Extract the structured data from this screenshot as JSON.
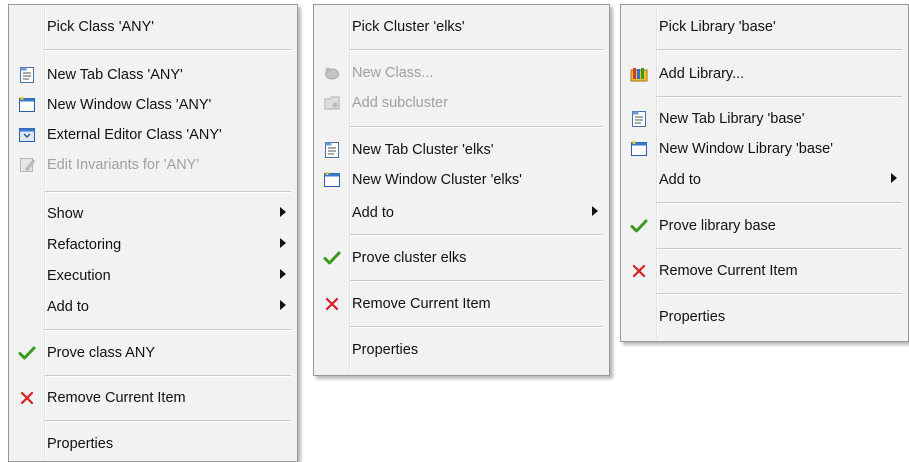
{
  "menus": [
    {
      "items": [
        {
          "label": "Pick Class 'ANY'",
          "icon": null,
          "submenu": false,
          "disabled": false
        },
        {
          "label": "New Tab Class 'ANY'",
          "icon": "new-tab-icon",
          "submenu": false,
          "disabled": false
        },
        {
          "label": "New Window Class 'ANY'",
          "icon": "new-window-icon",
          "submenu": false,
          "disabled": false
        },
        {
          "label": "External Editor Class 'ANY'",
          "icon": "external-editor-icon",
          "submenu": false,
          "disabled": false
        },
        {
          "label": "Edit Invariants for 'ANY'",
          "icon": "edit-invariants-icon",
          "submenu": false,
          "disabled": true
        },
        {
          "label": "Show",
          "icon": null,
          "submenu": true,
          "disabled": false
        },
        {
          "label": "Refactoring",
          "icon": null,
          "submenu": true,
          "disabled": false
        },
        {
          "label": "Execution",
          "icon": null,
          "submenu": true,
          "disabled": false
        },
        {
          "label": "Add to",
          "icon": null,
          "submenu": true,
          "disabled": false
        },
        {
          "label": "Prove class ANY",
          "icon": "check-icon",
          "submenu": false,
          "disabled": false
        },
        {
          "label": "Remove Current Item",
          "icon": "remove-icon",
          "submenu": false,
          "disabled": false
        },
        {
          "label": "Properties",
          "icon": null,
          "submenu": false,
          "disabled": false
        }
      ]
    },
    {
      "items": [
        {
          "label": "Pick Cluster 'elks'",
          "icon": null,
          "submenu": false,
          "disabled": false
        },
        {
          "label": "New Class...",
          "icon": "new-class-icon",
          "submenu": false,
          "disabled": true
        },
        {
          "label": "Add subcluster",
          "icon": "add-subcluster-icon",
          "submenu": false,
          "disabled": true
        },
        {
          "label": "New Tab Cluster 'elks'",
          "icon": "new-tab-icon",
          "submenu": false,
          "disabled": false
        },
        {
          "label": "New Window Cluster 'elks'",
          "icon": "new-window-icon",
          "submenu": false,
          "disabled": false
        },
        {
          "label": "Add to",
          "icon": null,
          "submenu": true,
          "disabled": false
        },
        {
          "label": "Prove cluster elks",
          "icon": "check-icon",
          "submenu": false,
          "disabled": false
        },
        {
          "label": "Remove Current Item",
          "icon": "remove-icon",
          "submenu": false,
          "disabled": false
        },
        {
          "label": "Properties",
          "icon": null,
          "submenu": false,
          "disabled": false
        }
      ]
    },
    {
      "items": [
        {
          "label": "Pick Library 'base'",
          "icon": null,
          "submenu": false,
          "disabled": false
        },
        {
          "label": "Add Library...",
          "icon": "add-library-icon",
          "submenu": false,
          "disabled": false
        },
        {
          "label": "New Tab Library 'base'",
          "icon": "new-tab-icon",
          "submenu": false,
          "disabled": false
        },
        {
          "label": "New Window Library 'base'",
          "icon": "new-window-icon",
          "submenu": false,
          "disabled": false
        },
        {
          "label": "Add to",
          "icon": null,
          "submenu": true,
          "disabled": false
        },
        {
          "label": "Prove library base",
          "icon": "check-icon",
          "submenu": false,
          "disabled": false
        },
        {
          "label": "Remove Current Item",
          "icon": "remove-icon",
          "submenu": false,
          "disabled": false
        },
        {
          "label": "Properties",
          "icon": null,
          "submenu": false,
          "disabled": false
        }
      ]
    }
  ],
  "colors": {
    "check": "#3a9a1e",
    "remove": "#d42020",
    "disabled_text": "#a0a0a0",
    "menu_bg": "#f2f2f2"
  }
}
